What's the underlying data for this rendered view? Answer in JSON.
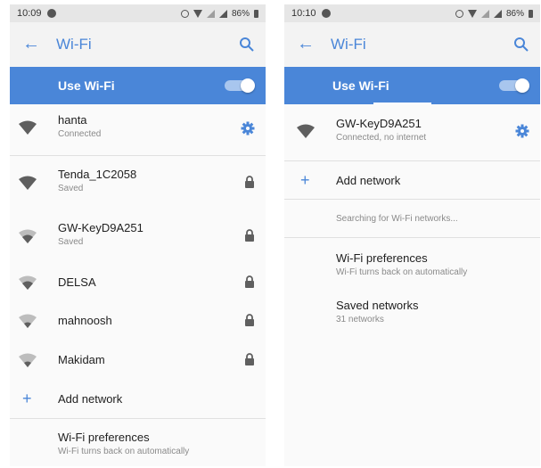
{
  "left": {
    "status": {
      "time": "10:09",
      "battery": "86%"
    },
    "app_bar": {
      "title": "Wi-Fi"
    },
    "toggle": {
      "label": "Use Wi-Fi",
      "on": true
    },
    "networks": [
      {
        "name": "hanta",
        "status": "Connected",
        "trailing": "gear-icon",
        "strength": "full"
      },
      {
        "name": "Tenda_1C2058",
        "status": "Saved",
        "trailing": "lock-icon",
        "strength": "full"
      },
      {
        "name": "GW-KeyD9A251",
        "status": "Saved",
        "trailing": "lock-icon",
        "strength": "medium"
      },
      {
        "name": "DELSA",
        "status": "",
        "trailing": "lock-icon",
        "strength": "medium"
      },
      {
        "name": "mahnoosh",
        "status": "",
        "trailing": "lock-icon",
        "strength": "low"
      },
      {
        "name": "Makidam",
        "status": "",
        "trailing": "lock-icon",
        "strength": "low"
      }
    ],
    "add_network": "Add network",
    "preferences": {
      "title": "Wi-Fi preferences",
      "subtitle": "Wi-Fi turns back on automatically"
    }
  },
  "right": {
    "status": {
      "time": "10:10",
      "battery": "86%"
    },
    "app_bar": {
      "title": "Wi-Fi"
    },
    "toggle": {
      "label": "Use Wi-Fi",
      "on": true
    },
    "current": {
      "name": "GW-KeyD9A251",
      "status": "Connected, no internet",
      "trailing": "gear-icon"
    },
    "add_network": "Add network",
    "searching": "Searching for Wi-Fi networks...",
    "preferences": {
      "title": "Wi-Fi preferences",
      "subtitle": "Wi-Fi turns back on automatically"
    },
    "saved": {
      "title": "Saved networks",
      "subtitle": "31 networks"
    }
  },
  "colors": {
    "accent": "#4a86d8",
    "wifi_strong": "#5f5f5f",
    "wifi_weak": "#bdbdbd"
  }
}
